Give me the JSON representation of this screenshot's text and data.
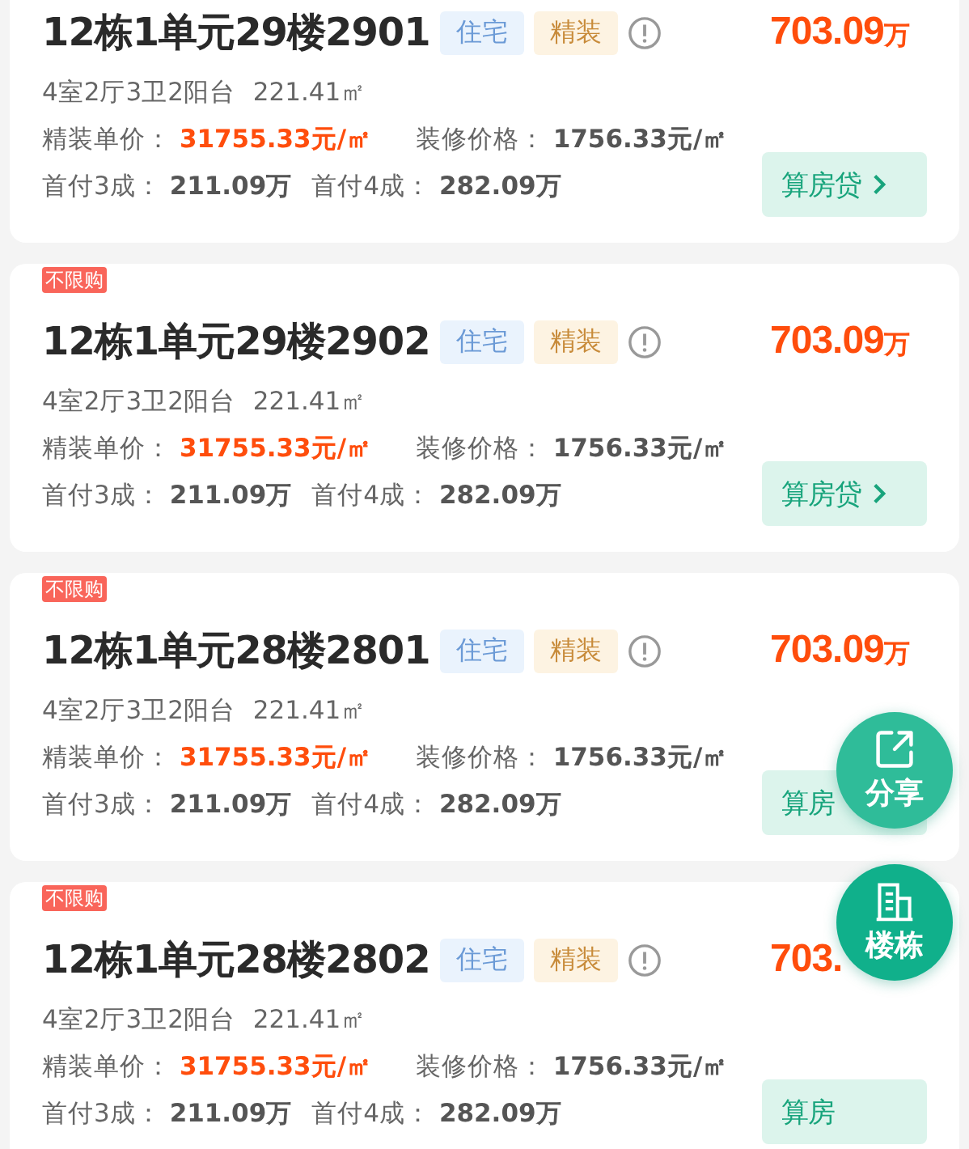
{
  "units": [
    {
      "title": "12栋1单元29楼2901",
      "tags": [
        {
          "label": "住宅",
          "kind": "type"
        },
        {
          "label": "精装",
          "kind": "finish"
        }
      ],
      "price": "703.09",
      "price_unit": "万",
      "layout": "4室2厅3卫2阳台",
      "area": "221.41㎡",
      "unit_price": {
        "label": "精装单价：",
        "value": "31755.33元/㎡"
      },
      "decor_price": {
        "label": "装修价格：",
        "value": "1756.33元/㎡"
      },
      "down_payments": [
        {
          "label": "首付3成：",
          "value": "211.09万"
        },
        {
          "label": "首付4成：",
          "value": "282.09万"
        }
      ],
      "loan_button": "算房贷",
      "loan_chevron": true
    },
    {
      "limit_badge": "不限购",
      "title": "12栋1单元29楼2902",
      "tags": [
        {
          "label": "住宅",
          "kind": "type"
        },
        {
          "label": "精装",
          "kind": "finish"
        }
      ],
      "price": "703.09",
      "price_unit": "万",
      "layout": "4室2厅3卫2阳台",
      "area": "221.41㎡",
      "unit_price": {
        "label": "精装单价：",
        "value": "31755.33元/㎡"
      },
      "decor_price": {
        "label": "装修价格：",
        "value": "1756.33元/㎡"
      },
      "down_payments": [
        {
          "label": "首付3成：",
          "value": "211.09万"
        },
        {
          "label": "首付4成：",
          "value": "282.09万"
        }
      ],
      "loan_button": "算房贷",
      "loan_chevron": true
    },
    {
      "limit_badge": "不限购",
      "title": "12栋1单元28楼2801",
      "tags": [
        {
          "label": "住宅",
          "kind": "type"
        },
        {
          "label": "精装",
          "kind": "finish"
        }
      ],
      "price": "703.09",
      "price_unit": "万",
      "layout": "4室2厅3卫2阳台",
      "area": "221.41㎡",
      "unit_price": {
        "label": "精装单价：",
        "value": "31755.33元/㎡"
      },
      "decor_price": {
        "label": "装修价格：",
        "value": "1756.33元/㎡"
      },
      "down_payments": [
        {
          "label": "首付3成：",
          "value": "211.09万"
        },
        {
          "label": "首付4成：",
          "value": "282.09万"
        }
      ],
      "loan_button": "算房",
      "loan_chevron": false
    },
    {
      "limit_badge": "不限购",
      "title": "12栋1单元28楼2802",
      "tags": [
        {
          "label": "住宅",
          "kind": "type"
        },
        {
          "label": "精装",
          "kind": "finish"
        }
      ],
      "price": "703.",
      "layout": "4室2厅3卫2阳台",
      "area": "221.41㎡",
      "unit_price": {
        "label": "精装单价：",
        "value": "31755.33元/㎡"
      },
      "decor_price": {
        "label": "装修价格：",
        "value": "1756.33元/㎡"
      },
      "down_payments": [
        {
          "label": "首付3成：",
          "value": "211.09万"
        },
        {
          "label": "首付4成：",
          "value": "282.09万"
        }
      ],
      "loan_button": "算房",
      "loan_chevron": false
    }
  ],
  "floating_buttons": [
    {
      "label": "分享",
      "kind": "share"
    },
    {
      "label": "楼栋",
      "kind": "building"
    }
  ]
}
